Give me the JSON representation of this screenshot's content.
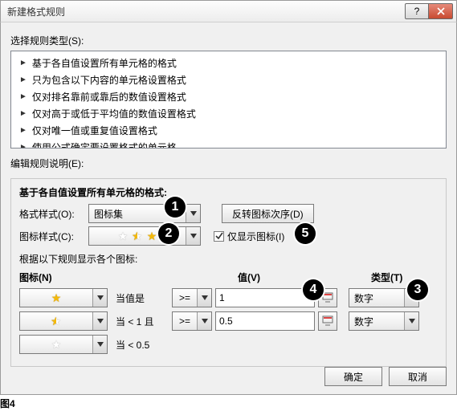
{
  "window": {
    "title": "新建格式规则",
    "help_glyph": "?",
    "close_label": "x"
  },
  "select_rule_type_label": "选择规则类型(S):",
  "rule_types": [
    "基于各自值设置所有单元格的格式",
    "只为包含以下内容的单元格设置格式",
    "仅对排名靠前或靠后的数值设置格式",
    "仅对高于或低于平均值的数值设置格式",
    "仅对唯一值或重复值设置格式",
    "使用公式确定要设置格式的单元格"
  ],
  "edit_label": "编辑规则说明(E):",
  "group_title": "基于各自值设置所有单元格的格式:",
  "format_style_label": "格式样式(O):",
  "format_style_value": "图标集",
  "reverse_btn": "反转图标次序(D)",
  "icon_style_label": "图标样式(C):",
  "show_icon_only": {
    "label": "仅显示图标(I)",
    "checked": true
  },
  "rules_sub_label": "根据以下规则显示各个图标:",
  "headers": {
    "icon": "图标(N)",
    "value": "值(V)",
    "type": "类型(T)"
  },
  "ops": [
    ">=",
    ">="
  ],
  "rules": [
    {
      "cond": "当值是",
      "op": ">=",
      "value": "1",
      "type": "数字",
      "icon": "gold"
    },
    {
      "cond": "当 < 1 且",
      "op": ">=",
      "value": "0.5",
      "type": "数字",
      "icon": "half"
    },
    {
      "cond": "当 < 0.5",
      "icon": "white"
    }
  ],
  "footer": {
    "ok": "确定",
    "cancel": "取消"
  },
  "caption": "图4",
  "annotations": {
    "1": "1",
    "2": "2",
    "3": "3",
    "4": "4",
    "5": "5"
  }
}
